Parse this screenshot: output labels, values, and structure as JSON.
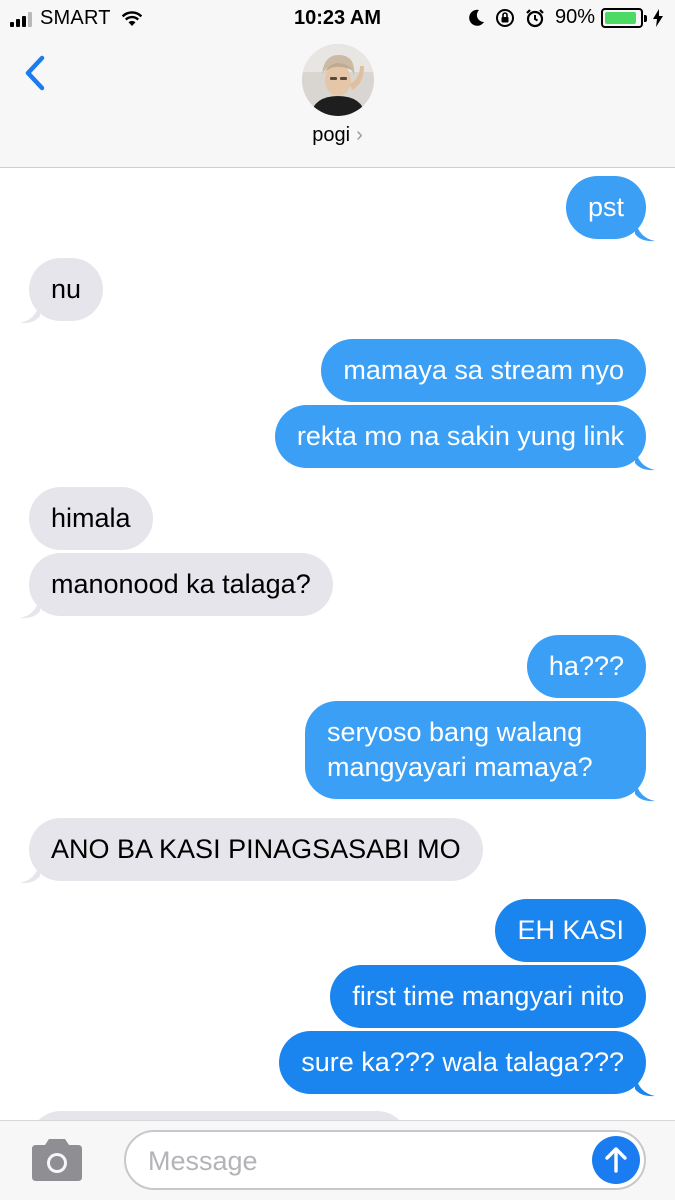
{
  "status_bar": {
    "carrier": "SMART",
    "time": "10:23 AM",
    "battery_percent": "90%",
    "battery_level": 0.9,
    "icons": [
      "signal-icon",
      "wifi-icon",
      "moon-icon",
      "orientation-lock-icon",
      "alarm-icon",
      "battery-icon",
      "charging-bolt-icon"
    ]
  },
  "header": {
    "contact_name": "pogi",
    "chevron": "›",
    "back_icon": "back-chevron-icon",
    "avatar": "contact-avatar"
  },
  "messages": [
    {
      "side": "out",
      "text": "pst"
    },
    {
      "side": "in",
      "text": "nu"
    },
    {
      "side": "out",
      "text": "mamaya sa stream nyo"
    },
    {
      "side": "out",
      "text": "rekta mo na sakin yung link"
    },
    {
      "side": "in",
      "text": "himala"
    },
    {
      "side": "in",
      "text": "manonood ka talaga?"
    },
    {
      "side": "out",
      "text": "ha???"
    },
    {
      "side": "out",
      "text": "seryoso bang walang mangyayari mamaya?"
    },
    {
      "side": "in",
      "text": "ANO BA KASI PINAGSASABI MO"
    },
    {
      "side": "out",
      "text": "EH KASI"
    },
    {
      "side": "out",
      "text": "first time mangyari nito"
    },
    {
      "side": "out",
      "text": "sure ka??? wala talaga???"
    }
  ],
  "input_bar": {
    "placeholder": "Message",
    "camera_icon": "camera-icon",
    "send_icon": "send-arrow-icon"
  },
  "colors": {
    "outgoing_bubble": "#3b9ff6",
    "outgoing_bubble_dark": "#1a84ef",
    "incoming_bubble": "#e6e5eb",
    "accent": "#1a7cf0",
    "battery_green": "#4cd964"
  }
}
